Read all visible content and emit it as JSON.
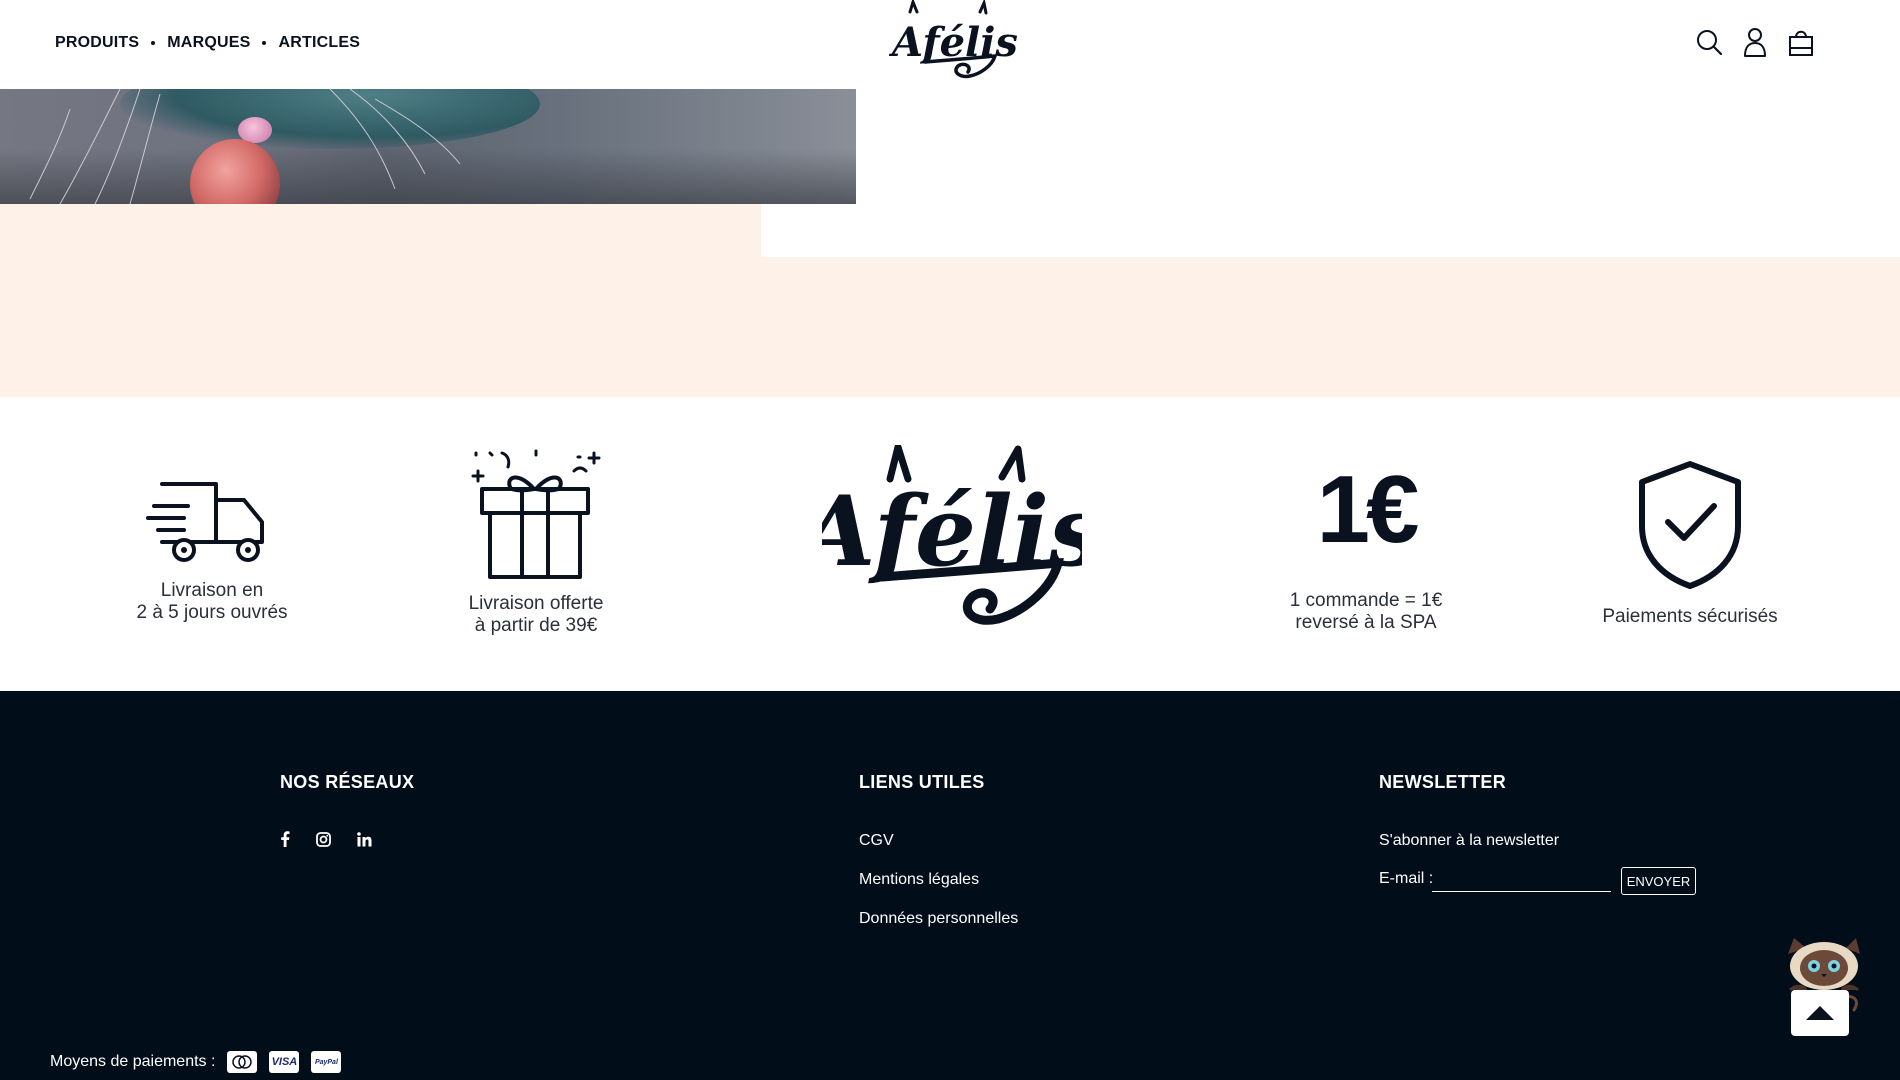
{
  "header": {
    "nav": [
      {
        "label": "PRODUITS"
      },
      {
        "label": "MARQUES"
      },
      {
        "label": "ARTICLES"
      }
    ],
    "logo_text": "Afélis",
    "icons": [
      "search-icon",
      "account-icon",
      "cart-icon"
    ]
  },
  "features": [
    {
      "icon": "truck-icon",
      "line1": "Livraison en",
      "line2": "2 à 5 jours ouvrés"
    },
    {
      "icon": "gift-icon",
      "line1": "Livraison offerte",
      "line2": "à partir de 39€"
    },
    {
      "icon": "afelis-logo",
      "logo_text": "Afélis"
    },
    {
      "icon": "one-euro-icon",
      "icon_text": "1€",
      "line1": "1 commande = 1€",
      "line2": "reversé à la SPA"
    },
    {
      "icon": "shield-check-icon",
      "line1": "Paiements sécurisés"
    }
  ],
  "footer": {
    "networks": {
      "title": "NOS RÉSEAUX",
      "items": [
        "facebook-icon",
        "instagram-icon",
        "linkedin-icon"
      ]
    },
    "links": {
      "title": "LIENS UTILES",
      "items": [
        "CGV",
        "Mentions légales",
        "Données personnelles"
      ]
    },
    "newsletter": {
      "title": "NEWSLETTER",
      "text": "S'abonner à la newsletter",
      "email_label": "E-mail :",
      "email_value": "",
      "button": "ENVOYER"
    },
    "payments": {
      "label": "Moyens de paiements :",
      "cards": [
        "Mastercard",
        "VISA",
        "PayPal"
      ]
    }
  },
  "colors": {
    "dark": "#020d1a",
    "peach": "#fdf1e8",
    "text": "#0a1220"
  }
}
